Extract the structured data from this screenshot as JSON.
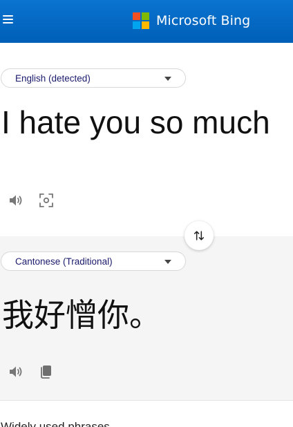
{
  "header": {
    "brand_text": "Microsoft Bing",
    "logo_colors": [
      "#f25022",
      "#7fba00",
      "#00a4ef",
      "#ffb900"
    ]
  },
  "source": {
    "language_label": "English (detected)",
    "text": "I hate you so much"
  },
  "target": {
    "language_label": "Cantonese (Traditional)",
    "text": "我好憎你。"
  },
  "phrases": {
    "heading": "Widely used phrases"
  },
  "colors": {
    "header_blue": "#0067c0",
    "target_panel_bg": "#f5f5f5",
    "language_text": "#1a1a6e"
  }
}
